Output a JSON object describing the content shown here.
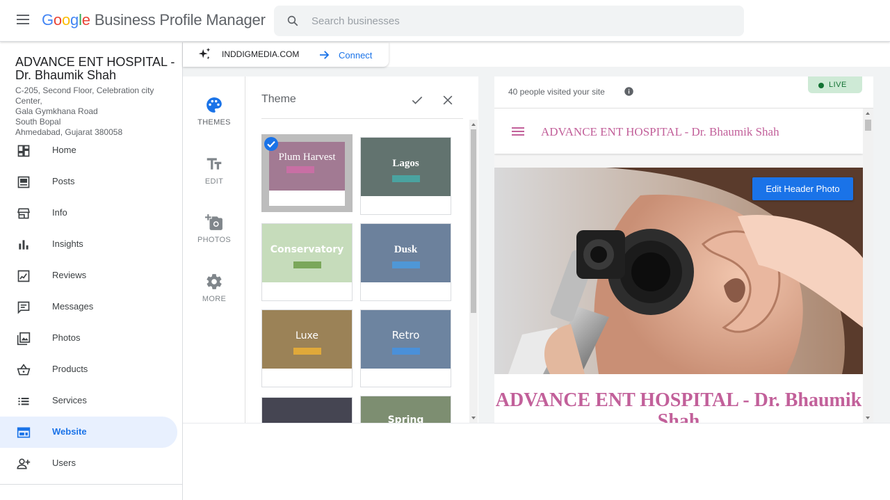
{
  "header": {
    "logo_google": [
      "G",
      "o",
      "o",
      "g",
      "l",
      "e"
    ],
    "product_name": "Business Profile Manager",
    "search_placeholder": "Search businesses"
  },
  "business": {
    "name": "ADVANCE ENT HOSPITAL - Dr. Bhaumik Shah",
    "address": "C-205, Second Floor, Celebration city Center,\nGala Gymkhana Road\nSouth Bopal\nAhmedabad, Gujarat 380058"
  },
  "nav": {
    "items": [
      {
        "label": "Home",
        "icon": "dashboard-icon"
      },
      {
        "label": "Posts",
        "icon": "posts-icon"
      },
      {
        "label": "Info",
        "icon": "store-icon"
      },
      {
        "label": "Insights",
        "icon": "bar-chart-icon"
      },
      {
        "label": "Reviews",
        "icon": "rate-review-icon"
      },
      {
        "label": "Messages",
        "icon": "chat-icon"
      },
      {
        "label": "Photos",
        "icon": "photo-library-icon"
      },
      {
        "label": "Products",
        "icon": "basket-icon"
      },
      {
        "label": "Services",
        "icon": "list-icon"
      },
      {
        "label": "Website",
        "icon": "web-icon",
        "active": true
      },
      {
        "label": "Users",
        "icon": "person-add-icon"
      }
    ]
  },
  "connect": {
    "domain": "INDDIGMEDIA.COM",
    "button_label": "Connect"
  },
  "tools": [
    {
      "label": "THEMES",
      "icon": "palette-icon",
      "active": true
    },
    {
      "label": "EDIT",
      "icon": "text-fields-icon"
    },
    {
      "label": "PHOTOS",
      "icon": "add-photo-icon"
    },
    {
      "label": "MORE",
      "icon": "gear-icon"
    }
  ],
  "theme_panel": {
    "title": "Theme",
    "themes": [
      {
        "name": "Plum Harvest",
        "color": "#a27a93",
        "bar": "#c86fa4",
        "selected": true
      },
      {
        "name": "Lagos",
        "color": "#62736f",
        "bar": "#4aa3a0"
      },
      {
        "name": "Conservatory",
        "color": "#c6dcbb",
        "bar": "#7aa75a"
      },
      {
        "name": "Dusk",
        "color": "#6c819c",
        "bar": "#4f97d6"
      },
      {
        "name": "Luxe",
        "color": "#9b8257",
        "bar": "#e0a93a"
      },
      {
        "name": "Retro",
        "color": "#6d84a0",
        "bar": "#4a90d9"
      },
      {
        "name": "",
        "color": "#454552",
        "bar": "#454552"
      },
      {
        "name": "Spring",
        "color": "#7d8e71",
        "bar": "#7d8e71"
      }
    ]
  },
  "preview": {
    "visits": "40 people visited your site",
    "live_label": "LIVE",
    "site_title": "ADVANCE ENT HOSPITAL - Dr. Bhaumik Shah",
    "edit_header_photo": "Edit Header Photo",
    "hero_title": "ADVANCE ENT HOSPITAL - Dr. Bhaumik Shah"
  }
}
